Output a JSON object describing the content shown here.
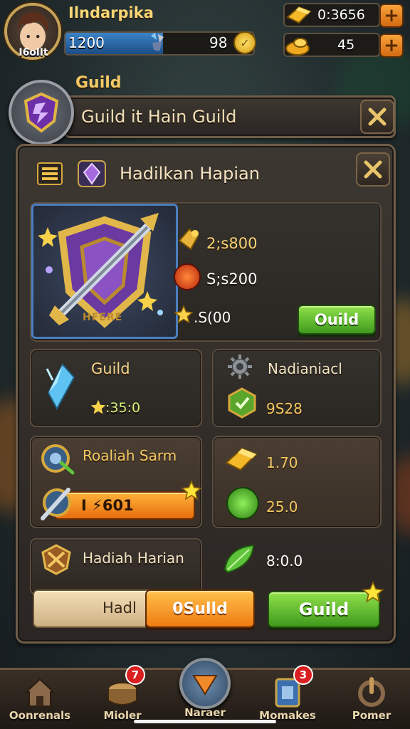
{
  "player": {
    "name": "Ilndarpika",
    "level": "I6olIt",
    "xp": "1200",
    "stat_value": "98"
  },
  "currency": {
    "gold": "0:3656",
    "nuggets": "45"
  },
  "guild_header": {
    "label": "Guild",
    "title": "Guild it Hain Guild"
  },
  "dialog": {
    "title": "Hadilkan Hapian",
    "shield_banner": "HFERE",
    "featured": {
      "reward1": "2;s800",
      "reward2": "S;s200",
      "reward3": ".S(00",
      "button": "Ouild"
    }
  },
  "cards": {
    "card1": {
      "title": "Guild",
      "value": ":35:0"
    },
    "card2": {
      "title": "Nadianiacl",
      "value": "9S28"
    },
    "card3": {
      "title": "Roaliah Sarm",
      "bar_value": "I  ⚡601"
    },
    "card4": {
      "value1": "1.70",
      "value2": "25.0"
    },
    "card5": {
      "title": "Hadiah Harian",
      "value": "8:0.0"
    }
  },
  "bottom_buttons": {
    "tab_label": "Hadl",
    "orange": "0Sulld",
    "green": "Guild"
  },
  "nav": [
    {
      "label": "Oonrenals",
      "badge": ""
    },
    {
      "label": "Mioler",
      "badge": "7"
    },
    {
      "label": "Naraer",
      "badge": ""
    },
    {
      "label": "Momakes",
      "badge": "3"
    },
    {
      "label": "Pomer",
      "badge": ""
    }
  ],
  "colors": {
    "accent_gold": "#f2c864",
    "button_green": "#5bbd2c",
    "button_orange": "#f29a22",
    "panel": "#2f2b27"
  }
}
